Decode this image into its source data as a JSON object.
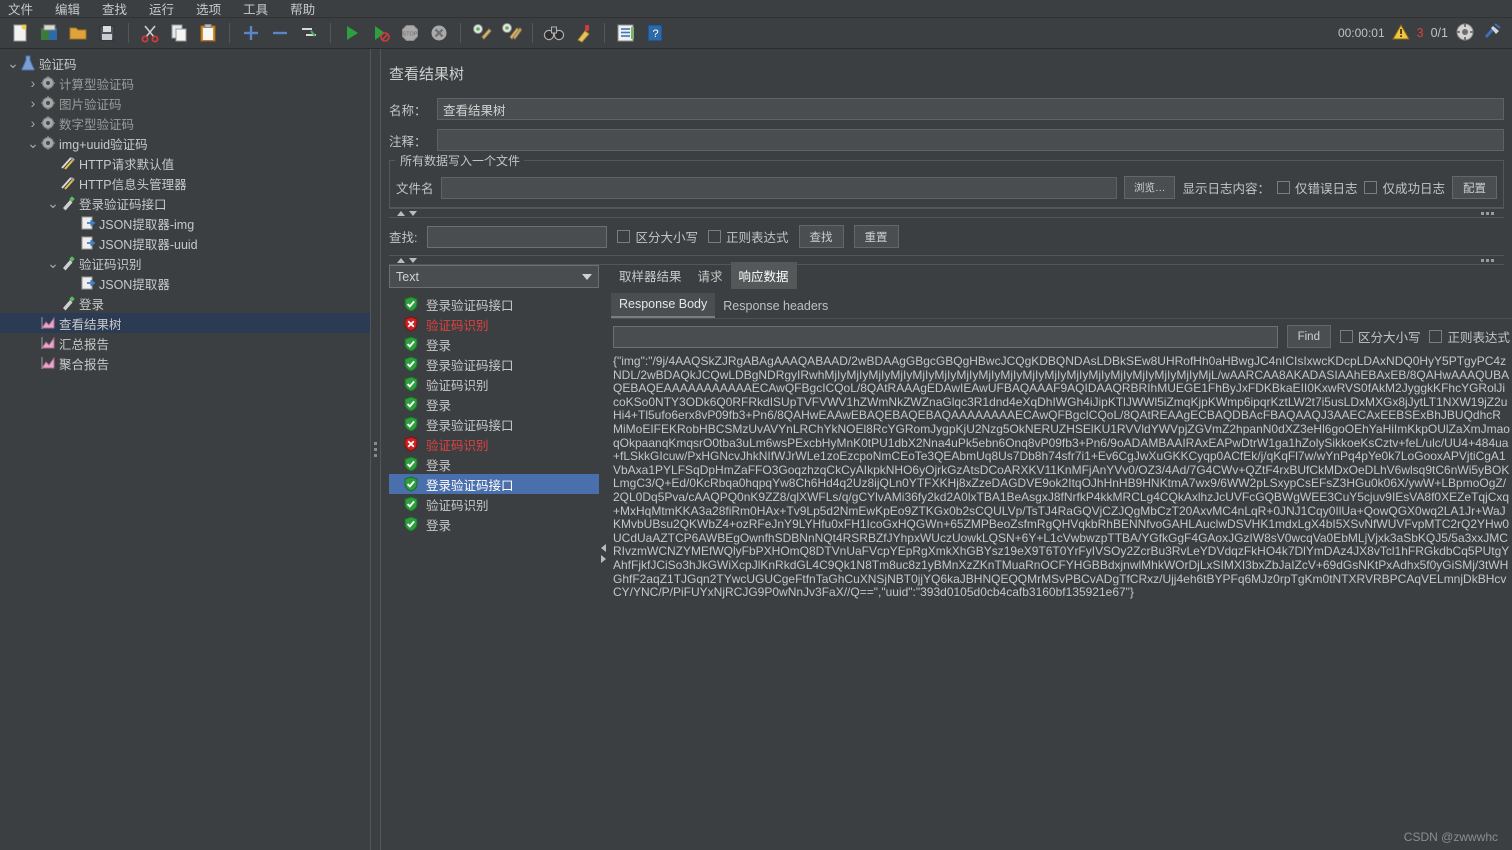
{
  "menubar": {
    "items": [
      {
        "label": "文件",
        "name": "menu-file"
      },
      {
        "label": "编辑",
        "name": "menu-edit"
      },
      {
        "label": "查找",
        "name": "menu-search"
      },
      {
        "label": "运行",
        "name": "menu-run"
      },
      {
        "label": "选项",
        "name": "menu-options"
      },
      {
        "label": "工具",
        "name": "menu-tools"
      },
      {
        "label": "帮助",
        "name": "menu-help"
      }
    ]
  },
  "toolbar": {
    "buttons": [
      {
        "icon": "new-file-icon"
      },
      {
        "icon": "open-templates-icon"
      },
      {
        "icon": "open-folder-icon"
      },
      {
        "icon": "save-icon"
      },
      {
        "sep": true
      },
      {
        "icon": "cut-icon"
      },
      {
        "icon": "copy-icon"
      },
      {
        "icon": "paste-icon"
      },
      {
        "sep": true
      },
      {
        "icon": "expand-all-icon"
      },
      {
        "icon": "collapse-all-icon"
      },
      {
        "icon": "toggle-icon"
      },
      {
        "sep": true
      },
      {
        "icon": "start-icon"
      },
      {
        "icon": "start-no-pauses-icon"
      },
      {
        "icon": "stop-icon"
      },
      {
        "icon": "shutdown-icon"
      },
      {
        "sep": true
      },
      {
        "icon": "clear-icon"
      },
      {
        "icon": "clear-all-icon"
      },
      {
        "sep": true
      },
      {
        "icon": "search-binoculars-icon"
      },
      {
        "icon": "reset-search-icon"
      },
      {
        "sep": true
      },
      {
        "icon": "function-helper-icon"
      },
      {
        "icon": "help-icon"
      }
    ],
    "timer": "00:00:01",
    "warning_icon": "warning-triangle-icon",
    "error_count": "3",
    "thread_count": "0/1",
    "connect_icon": "remote-connect-icon",
    "shutdown_all_icon": "remote-shutdown-icon"
  },
  "tree": {
    "nodes": [
      {
        "label": "验证码",
        "icon": "test-plan-icon",
        "depth": 0,
        "twist": "v",
        "dim": false,
        "selected": false
      },
      {
        "label": "计算型验证码",
        "icon": "thread-group-icon",
        "depth": 1,
        "twist": ">",
        "dim": true,
        "selected": false
      },
      {
        "label": "图片验证码",
        "icon": "thread-group-icon",
        "depth": 1,
        "twist": ">",
        "dim": true,
        "selected": false
      },
      {
        "label": "数字型验证码",
        "icon": "thread-group-icon",
        "depth": 1,
        "twist": ">",
        "dim": true,
        "selected": false
      },
      {
        "label": "img+uuid验证码",
        "icon": "thread-group-icon",
        "depth": 1,
        "twist": "v",
        "dim": false,
        "selected": false
      },
      {
        "label": "HTTP请求默认值",
        "icon": "config-icon",
        "depth": 2,
        "twist": "",
        "dim": false,
        "selected": false
      },
      {
        "label": "HTTP信息头管理器",
        "icon": "config-icon",
        "depth": 2,
        "twist": "",
        "dim": false,
        "selected": false
      },
      {
        "label": "登录验证码接口",
        "icon": "sampler-icon",
        "depth": 2,
        "twist": "v",
        "dim": false,
        "selected": false
      },
      {
        "label": "JSON提取器-img",
        "icon": "postprocessor-icon",
        "depth": 3,
        "twist": "",
        "dim": false,
        "selected": false
      },
      {
        "label": "JSON提取器-uuid",
        "icon": "postprocessor-icon",
        "depth": 3,
        "twist": "",
        "dim": false,
        "selected": false
      },
      {
        "label": "验证码识别",
        "icon": "sampler-icon",
        "depth": 2,
        "twist": "v",
        "dim": false,
        "selected": false
      },
      {
        "label": "JSON提取器",
        "icon": "postprocessor-icon",
        "depth": 3,
        "twist": "",
        "dim": false,
        "selected": false
      },
      {
        "label": "登录",
        "icon": "sampler-icon",
        "depth": 2,
        "twist": "",
        "dim": false,
        "selected": false
      },
      {
        "label": "查看结果树",
        "icon": "listener-icon",
        "depth": 1,
        "twist": "",
        "dim": false,
        "selected": true
      },
      {
        "label": "汇总报告",
        "icon": "listener-icon",
        "depth": 1,
        "twist": "",
        "dim": false,
        "selected": false
      },
      {
        "label": "聚合报告",
        "icon": "listener-icon",
        "depth": 1,
        "twist": "",
        "dim": false,
        "selected": false
      }
    ]
  },
  "panel": {
    "title": "查看结果树",
    "name_label": "名称：",
    "name_value": "查看结果树",
    "comment_label": "注释：",
    "comment_value": "",
    "group_legend": "所有数据写入一个文件",
    "filename_label": "文件名",
    "filename_value": "",
    "browse_button": "浏览…",
    "display_log_label": "显示日志内容：",
    "errors_only_label": "仅错误日志",
    "successes_only_label": "仅成功日志",
    "configure_button": "配置"
  },
  "search": {
    "label": "查找:",
    "value": "",
    "case_sensitive_label": "区分大小写",
    "regex_label": "正则表达式",
    "find_button": "查找",
    "reset_button": "重置"
  },
  "results": {
    "renderer_selected": "Text",
    "items": [
      {
        "label": "登录验证码接口",
        "status": "ok",
        "selected": false
      },
      {
        "label": "验证码识别",
        "status": "error",
        "selected": false
      },
      {
        "label": "登录",
        "status": "ok",
        "selected": false
      },
      {
        "label": "登录验证码接口",
        "status": "ok",
        "selected": false
      },
      {
        "label": "验证码识别",
        "status": "ok",
        "selected": false
      },
      {
        "label": "登录",
        "status": "ok",
        "selected": false
      },
      {
        "label": "登录验证码接口",
        "status": "ok",
        "selected": false
      },
      {
        "label": "验证码识别",
        "status": "error",
        "selected": false
      },
      {
        "label": "登录",
        "status": "ok",
        "selected": false
      },
      {
        "label": "登录验证码接口",
        "status": "ok",
        "selected": true
      },
      {
        "label": "验证码识别",
        "status": "ok",
        "selected": false
      },
      {
        "label": "登录",
        "status": "ok",
        "selected": false
      }
    ]
  },
  "detail": {
    "tabs": [
      {
        "label": "取样器结果",
        "active": false
      },
      {
        "label": "请求",
        "active": false
      },
      {
        "label": "响应数据",
        "active": true
      }
    ],
    "subtabs": [
      {
        "label": "Response Body",
        "active": true
      },
      {
        "label": "Response headers",
        "active": false
      }
    ],
    "find_value": "",
    "find_button": "Find",
    "case_sensitive_label": "区分大小写",
    "regex_label": "正则表达式",
    "response_body": "{\"img\":\"/9j/4AAQSkZJRgABAgAAAQABAAD/2wBDAAgGBgcGBQgHBwcJCQgKDBQNDAsLDBkSEw8UHRofHh0aHBwgJC4nICIsIxwcKDcpLDAxNDQ0HyY5PTgyPC4zNDL/2wBDAQkJCQwLDBgNDRgyIRwhMjIyMjIyMjIyMjIyMjIyMjIyMjIyMjIyMjIyMjIyMjIyMjIyMjIyMjIyMjIyMjIyMjIyMjL/wAARCAA8AKADASIAAhEBAxEB/8QAHwAAAQUBAQEBAQEAAAAAAAAAAAECAwQFBgcICQoL/8QAtRAAAgEDAwIEAwUFBAQAAAF9AQIDAAQRBRIhMUEGE1FhByJxFDKBkaEII0KxwRVS0fAkM2JyggkKFhcYGRolJicoKSo0NTY3ODk6Q0RFRkdISUpTVFVWV1hZWmNkZWZnaGlqc3R1dnd4eXqDhIWGh4iJipKTlJWWl5iZmqKjpKWmp6ipqrKztLW2t7i5usLDxMXGx8jJytLT1NXW19jZ2uHi4+Tl5ufo6erx8vP09fb3+Pn6/8QAHwEAAwEBAQEBAQEBAQAAAAAAAAECAwQFBgcICQoL/8QAtREAAgECBAQDBAcFBAQAAQJ3AAECAxEEBSExBhJBUQdhcRMiMoEIFEKRobHBCSMzUvAVYnLRChYkNOEl8RcYGRomJygpKjU2Nzg5OkNERUZHSElKU1RVVldYWVpjZGVmZ2hpanN0dXZ3eHl6goOEhYaHiImKkpOUlZaXmJmaoqOkpaanqKmqsrO0tba3uLm6wsPExcbHyMnK0tPU1dbX2Nna4uPk5ebn6Onq8vP09fb3+Pn6/9oADAMBAAIRAxEAPwDtrW1ga1hZolySikkoeKsCztv+feL/ulc/UU4+484ua+fLSkkGIcuw/PxHGNcvJhkNIfWJrWLe1zoEzcpoNmCEoTe3QEAbmUq8Us7Db8h74sfr7i1+Ev6CgJwXuGKKCyqp0ACfEk/j/qKqFl7w/wYnPq4pYe0k7LoGooxAPVjtiCgA1VbAxa1PYLFSqDpHmZaFFO3GoqzhzqCkCyAIkpkNHO6yOjrkGzAtsDCoARXKV11KnMFjAnYVv0/OZ3/4Ad/7G4CWv+QZtF4rxBUfCkMDxOeDLhV6wlsq9tC6nWi5yBOKLmgC3/Q+Ed/0KcRbqa0hqpqYw8Ch6Hd4q2Uz8ijQLn0YTFXKHj8xZzeDAGDVE9ok2ItqOJhHnHB9HNKtmA7wx9/6WW2pLSxypCsEFsZ3HGu0k06X/ywW+LBpmoOgZ/2QL0Dq5Pva/cAAQPQ0nK9ZZ8/qlXWFLs/q/gCYlvAMi36fy2kd2A0lxTBA1BeAsgxJ8fNrfkP4kkMRCLg4CQkAxlhzJcUVFcGQBWgWEE3CuY5cjuv9IEsVA8f0XEZeTqjCxq+MxHqMtmKKA3a28fiRm0HAx+Tv9Lp5d2NmEwKpEo9ZTKGx0b2sCQULVp/TsTJ4RaGQVjCZJQgMbCzT20AxvMC4nLqR+0JNJ1Cqy0IlUa+QowQGX0wq2LA1Jr+WaJKMvbUBsu2QKWbZ4+ozRFeJnY9LYHfu0xFH1IcoGxHQGWn+65ZMPBeoZsfmRgQHVqkbRhBENNfvoGAHLAuclwDSVHK1mdxLgX4bI5XSvNfWUVFvpMTC2rQ2YHw0UCdUaAZTCP6AWBEgOwnfhSDBNnNQt4RSRBZfJYhpxWUczUowkLQSN+6Y+L1cVwbwzpTTBA/YGfkGgF4GAoxJGzIW8sV0wcqVa0EbMLjVjxk3aSbKQJ5/5a3xxJMCRIvzmWCNZYMEfWQlyFbPXHOmQ8DTVnUaFVcpYEpRgXmkXhGBYsz19eX9T6T0YrFyIVSOy2ZcrBu3RvLeYDVdqzFkHO4k7DlYmDAz4JX8vTcl1hFRGkdbCq5PUtgYAhfFjkfJCiSo3hJkGWiXcpJlKnRkdGL4C9Qk1N8Tm8uc8z1yBMnXzZKnTMuaRnOCFYHGBBdxjnwlMhkWOrDjLxSIMXI3bxZbJaIZcV+69dGsNKtPxAdhx5f0yGiSMj/3tWHGhfF2aqZ1TJGqn2TYwcUGUCgeFtfnTaGhCuXNSjNBT0jjYQ6kaJBHNQEQQMrMSvPBCvADgTfCRxz/Ujj4eh6tBYPFq6MJz0rpTgKm0tNTXRVRBPCAqVELmnjDkBHcvCY/YNC/P/PiFUYxNjRCJG9P0wNnJv3FaX//Q==\",\"uuid\":\"393d0105d0cb4cafb3160bf135921e67\"}"
  },
  "watermark": "CSDN @zwwwhc",
  "colors": {
    "bg": "#3c3f41",
    "selection": "#4a6fad",
    "tree_selection": "#2b3b54",
    "error_red": "#e04040",
    "text": "#c8c8c8"
  }
}
